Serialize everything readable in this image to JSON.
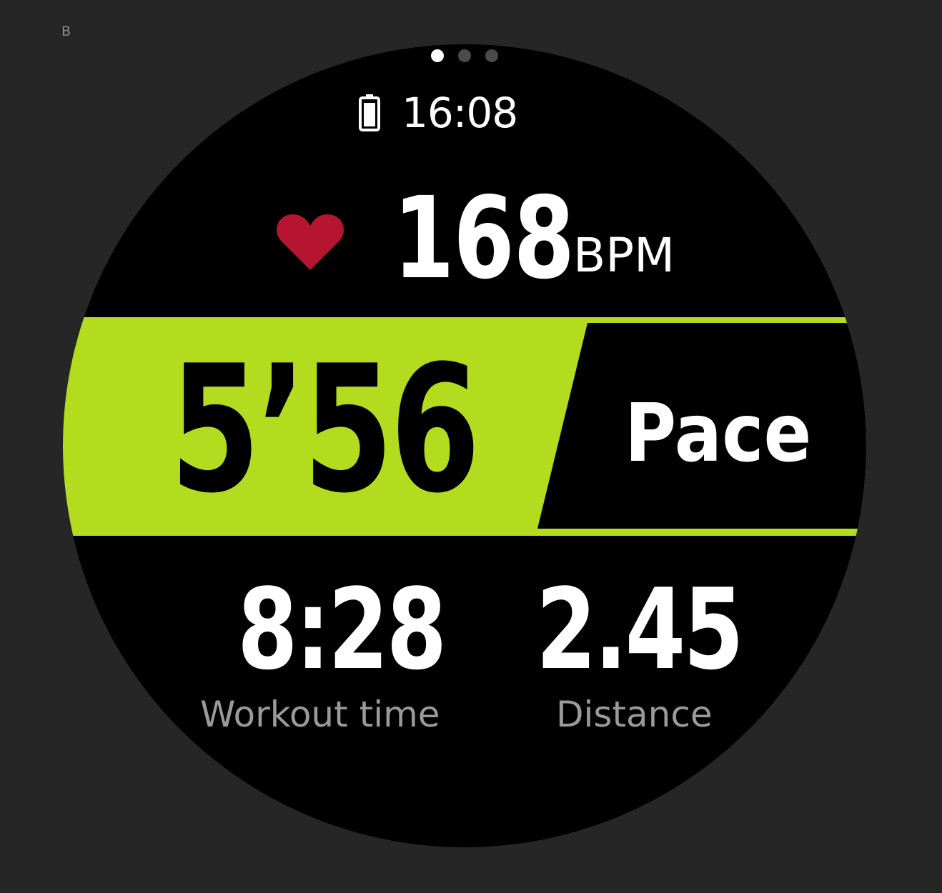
{
  "corner_label": "B",
  "page_indicator": {
    "dots": 3,
    "active": 0
  },
  "status": {
    "battery_icon": "battery-icon",
    "time": "16:08"
  },
  "heart_rate": {
    "icon": "heart-icon",
    "value": "168",
    "unit": "BPM"
  },
  "pace": {
    "value": "5’56",
    "label": "Pace"
  },
  "workout_time": {
    "value": "8:28",
    "label": "Workout time"
  },
  "distance": {
    "value": "2.45",
    "label": "Distance"
  },
  "colors": {
    "background": "#262626",
    "watch_face": "#000000",
    "accent_green": "#b4dc1e",
    "heart_red": "#b5152f",
    "label_gray": "#9a9a9a"
  }
}
